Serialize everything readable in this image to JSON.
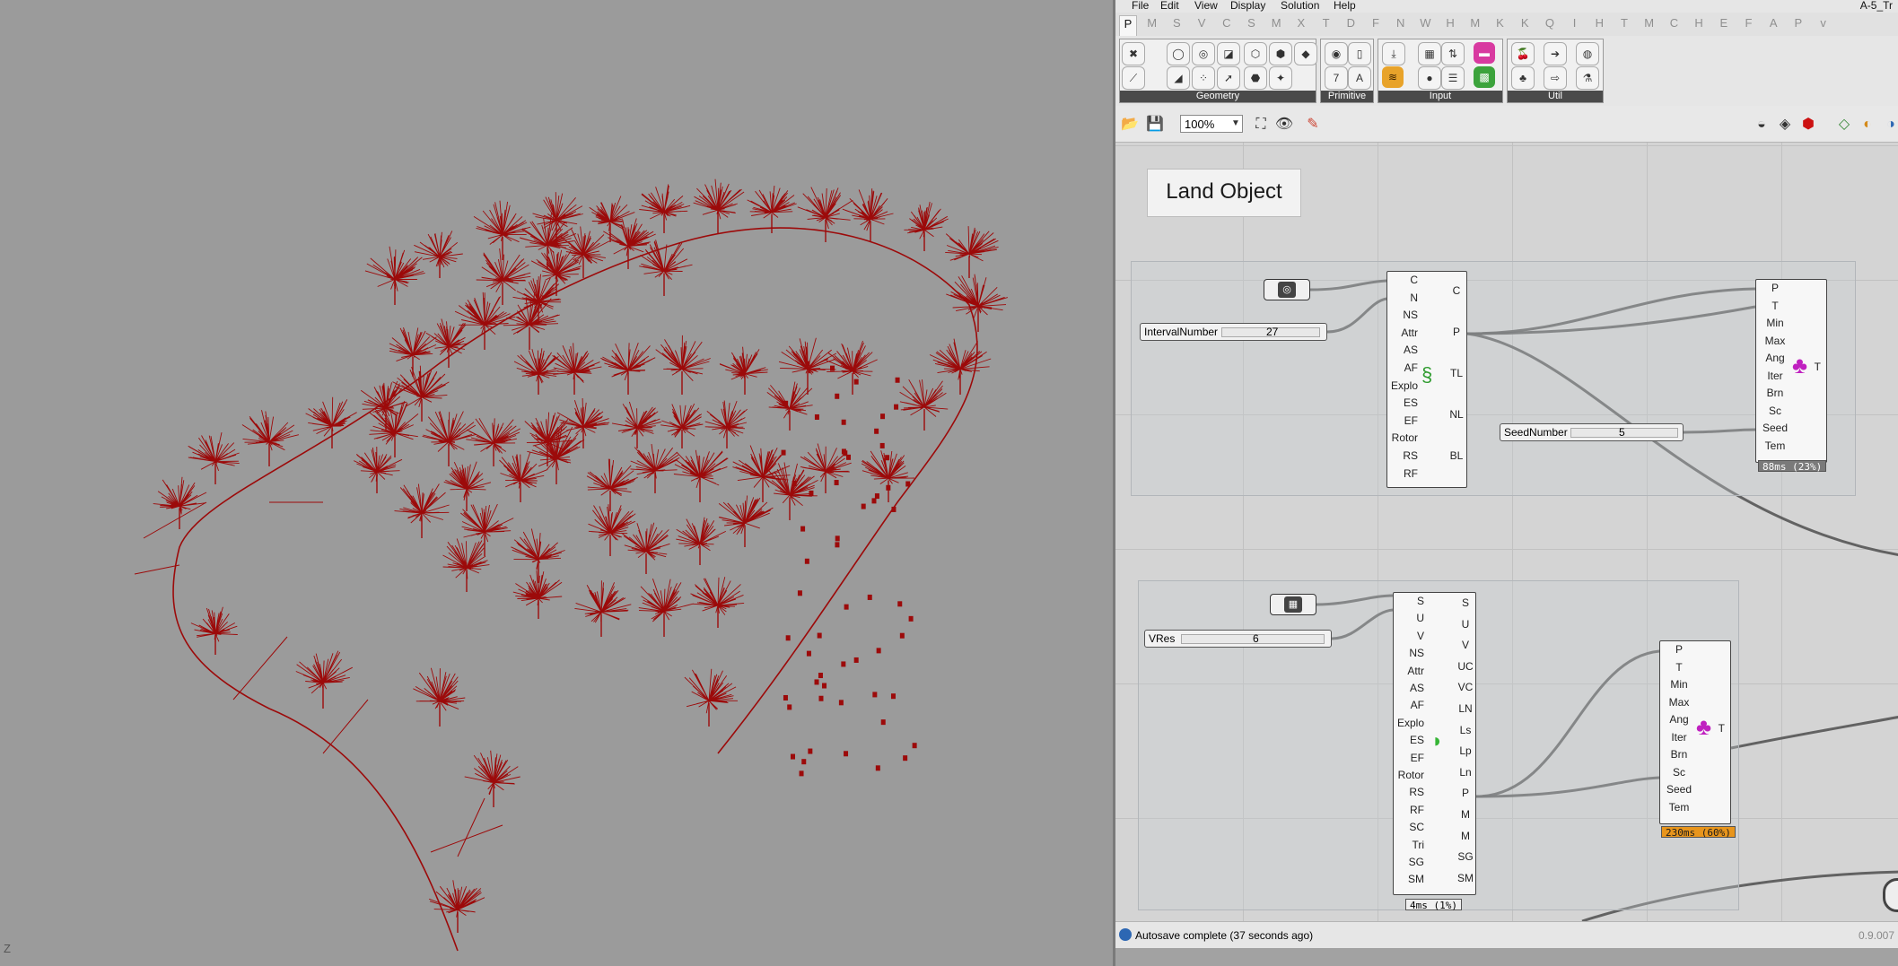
{
  "viewport": {
    "axis_label": "Z",
    "tree_color": "#9c0a0a",
    "background": "#9b9b9b"
  },
  "window": {
    "title": "A-5_Tr"
  },
  "menu": [
    "File",
    "Edit",
    "View",
    "Display",
    "Solution",
    "Help"
  ],
  "tabs": [
    "P",
    "M",
    "S",
    "V",
    "C",
    "S",
    "M",
    "X",
    "T",
    "D",
    "F",
    "N",
    "W",
    "H",
    "M",
    "K",
    "K",
    "Q",
    "I",
    "H",
    "T",
    "M",
    "C",
    "H",
    "E",
    "F",
    "A",
    "P",
    "v"
  ],
  "ribbon_panels": [
    {
      "label": "Geometry"
    },
    {
      "label": "Primitive"
    },
    {
      "label": "Input"
    },
    {
      "label": "Util"
    }
  ],
  "canvas_toolbar": {
    "zoom": "100%"
  },
  "canvas": {
    "title_note": "Land Object",
    "sliders": [
      {
        "label": "IntervalNumber",
        "value": "27"
      },
      {
        "label": "SeedNumber",
        "value": "5"
      },
      {
        "label": "VRes",
        "value": "6"
      }
    ],
    "component_a": {
      "inputs": [
        "C",
        "N",
        "NS",
        "Attr",
        "AS",
        "AF",
        "Explo",
        "ES",
        "EF",
        "Rotor",
        "RS",
        "RF"
      ],
      "outputs": [
        "C",
        "P",
        "TL",
        "NL",
        "BL"
      ]
    },
    "component_b": {
      "inputs": [
        "S",
        "U",
        "V",
        "NS",
        "Attr",
        "AS",
        "AF",
        "Explo",
        "ES",
        "EF",
        "Rotor",
        "RS",
        "RF",
        "SC",
        "Tri",
        "SG",
        "SM"
      ],
      "outputs": [
        "S",
        "U",
        "V",
        "UC",
        "VC",
        "LN",
        "Ls",
        "Lp",
        "Ln",
        "P",
        "M",
        "M",
        "SG",
        "SM"
      ],
      "timer": "4ms (1%)"
    },
    "tree_component_1": {
      "inputs": [
        "P",
        "T",
        "Min",
        "Max",
        "Ang",
        "Iter",
        "Brn",
        "Sc",
        "Seed",
        "Tem"
      ],
      "output": "T",
      "timer": "88ms (23%)"
    },
    "tree_component_2": {
      "inputs": [
        "P",
        "T",
        "Min",
        "Max",
        "Ang",
        "Iter",
        "Brn",
        "Sc",
        "Seed",
        "Tem"
      ],
      "output": "T",
      "timer": "230ms (60%)"
    }
  },
  "status": {
    "message": "Autosave complete (37 seconds ago)",
    "version": "0.9.007"
  }
}
